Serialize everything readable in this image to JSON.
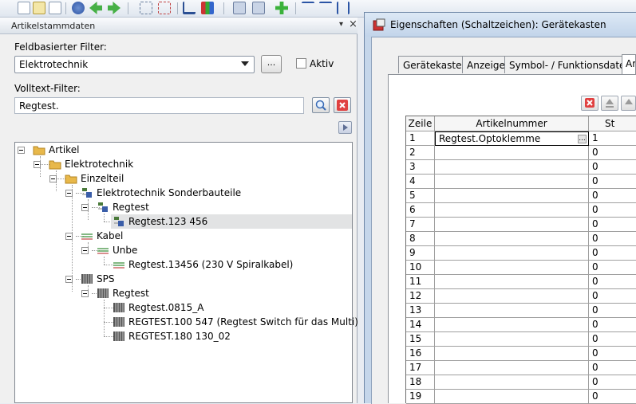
{
  "toolbar": {
    "buttons": [
      "new-icon",
      "open-icon",
      "copy-icon",
      "undo-icon",
      "back-icon",
      "forward-icon",
      "select-icon",
      "cut-icon",
      "cart-icon",
      "chart-icon",
      "layers-icon",
      "layers2-icon",
      "add-icon",
      "grid-icon",
      "grid2-icon",
      "align-icon"
    ]
  },
  "left_panel": {
    "title": "Artikelstammdaten",
    "pin": "▾",
    "close": "×",
    "filter_label": "Feldbasierter Filter:",
    "filter_value": "Elektrotechnik",
    "ellipsis_label": "...",
    "aktiv_label": "Aktiv",
    "volltext_label": "Volltext-Filter:",
    "volltext_value": "Regtest."
  },
  "tree": {
    "items": [
      {
        "label": "Artikel",
        "icon": "folder-icon"
      },
      {
        "label": "Elektrotechnik",
        "icon": "folder-icon"
      },
      {
        "label": "Einzelteil",
        "icon": "folder-icon"
      },
      {
        "label": "Elektrotechnik Sonderbauteile",
        "icon": "component-icon"
      },
      {
        "label": "Regtest",
        "icon": "component-icon"
      },
      {
        "label": "Regtest.123 456",
        "icon": "component-icon"
      },
      {
        "label": "Kabel",
        "icon": "cable-icon"
      },
      {
        "label": "Unbe",
        "icon": "cable-icon"
      },
      {
        "label": "Regtest.13456 (230 V Spiralkabel)",
        "icon": "cable-icon"
      },
      {
        "label": "SPS",
        "icon": "plc-icon"
      },
      {
        "label": "Regtest",
        "icon": "plc-icon"
      },
      {
        "label": "Regtest.0815_A",
        "icon": "plc-icon"
      },
      {
        "label": "REGTEST.100 547 (Regtest Switch für das Multi)",
        "icon": "plc-icon"
      },
      {
        "label": "REGTEST.180 130_02",
        "icon": "plc-icon"
      }
    ]
  },
  "dialog": {
    "title": "Eigenschaften (Schaltzeichen): Gerätekasten",
    "tabs": [
      "Gerätekasten",
      "Anzeige",
      "Symbol- / Funktionsdaten",
      "Ar"
    ],
    "grid": {
      "headers": [
        "Zeile",
        "Artikelnummer",
        "St"
      ],
      "rows": [
        [
          "1",
          "Regtest.Optoklemme",
          "1"
        ],
        [
          "2",
          "",
          "0"
        ],
        [
          "3",
          "",
          "0"
        ],
        [
          "4",
          "",
          "0"
        ],
        [
          "5",
          "",
          "0"
        ],
        [
          "6",
          "",
          "0"
        ],
        [
          "7",
          "",
          "0"
        ],
        [
          "8",
          "",
          "0"
        ],
        [
          "9",
          "",
          "0"
        ],
        [
          "10",
          "",
          "0"
        ],
        [
          "11",
          "",
          "0"
        ],
        [
          "12",
          "",
          "0"
        ],
        [
          "13",
          "",
          "0"
        ],
        [
          "14",
          "",
          "0"
        ],
        [
          "15",
          "",
          "0"
        ],
        [
          "16",
          "",
          "0"
        ],
        [
          "17",
          "",
          "0"
        ],
        [
          "18",
          "",
          "0"
        ],
        [
          "19",
          "",
          "0"
        ]
      ],
      "cell_ellipsis": "..."
    }
  }
}
